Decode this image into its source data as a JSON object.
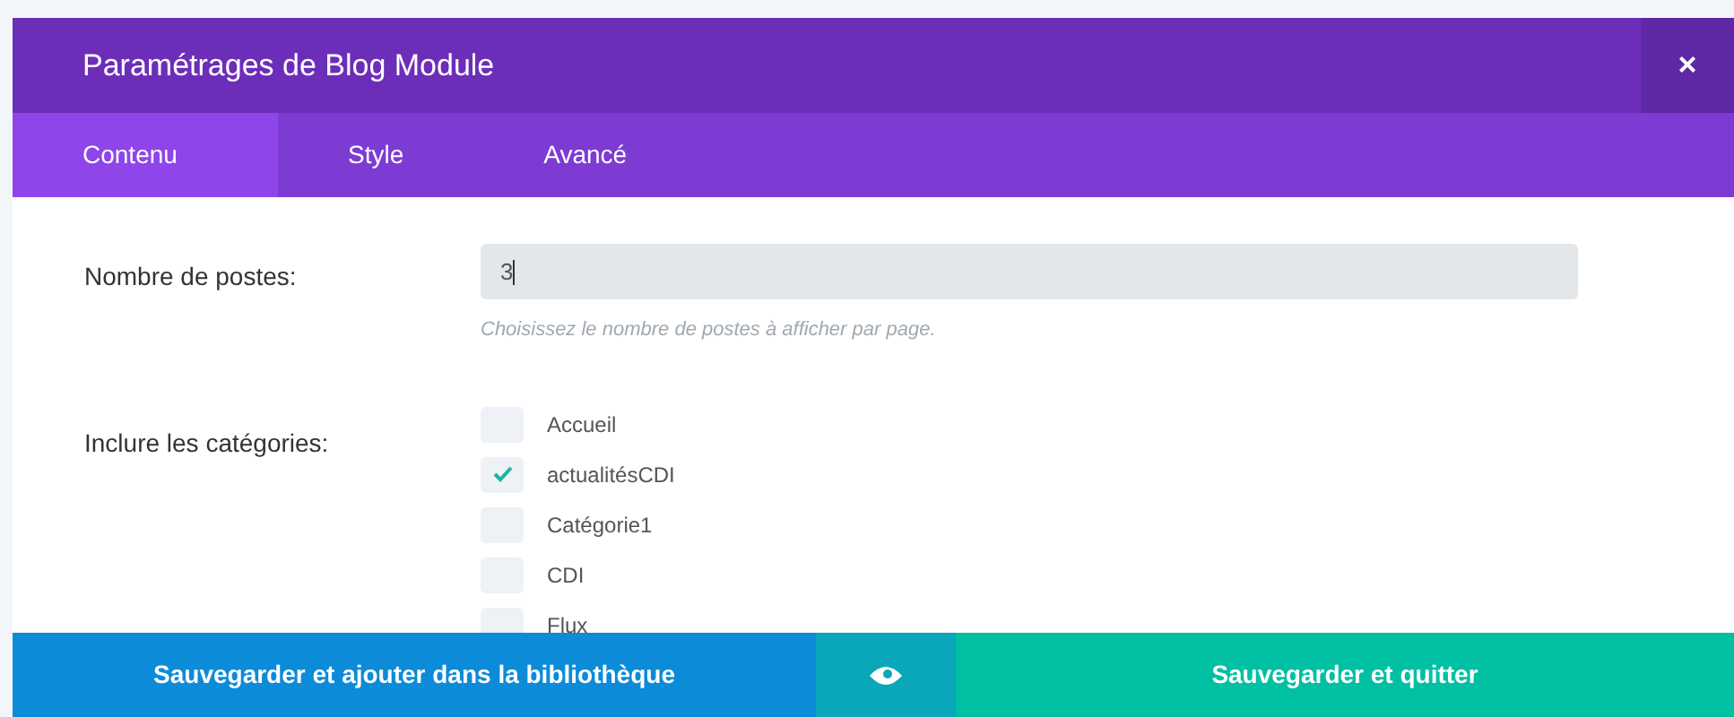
{
  "modal": {
    "title": "Paramétrages de Blog Module",
    "close": "×"
  },
  "tabs": [
    {
      "label": "Contenu",
      "selected": true
    },
    {
      "label": "Style",
      "selected": false
    },
    {
      "label": "Avancé",
      "selected": false
    }
  ],
  "fields": [
    {
      "kind": "number",
      "label": "Nombre de postes:",
      "value": "3",
      "help": "Choisissez le nombre de postes à afficher par page."
    },
    {
      "kind": "checklist",
      "label": "Inclure les catégories:",
      "options": [
        {
          "label": "Accueil",
          "checked": false
        },
        {
          "label": "actualitésCDI",
          "checked": true
        },
        {
          "label": "Catégorie1",
          "checked": false
        },
        {
          "label": "CDI",
          "checked": false
        },
        {
          "label": "Flux",
          "checked": false
        }
      ]
    }
  ],
  "footer": {
    "save_library": "Sauvegarder et ajouter dans la bibliothèque",
    "save_quit": "Sauvegarder et quitter"
  }
}
